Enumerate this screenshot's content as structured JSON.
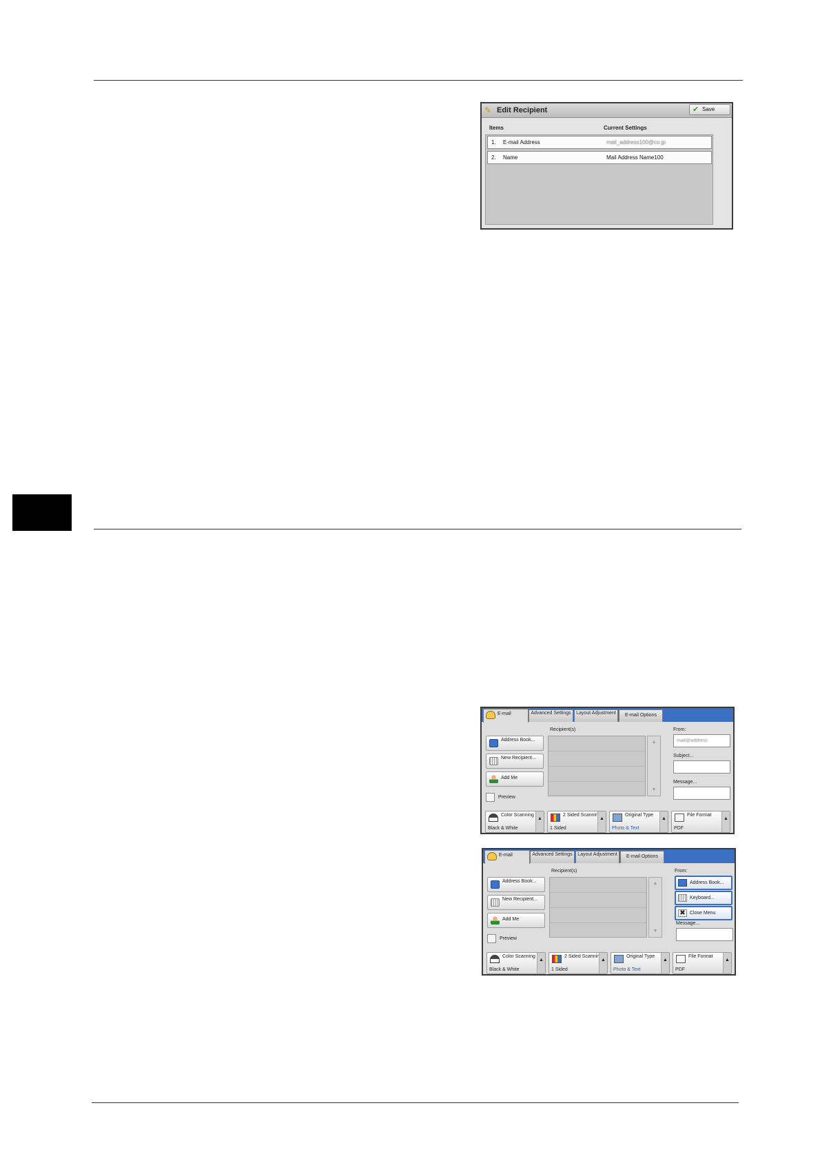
{
  "edit_recipient": {
    "title": "Edit Recipient",
    "save_label": "Save",
    "col_items": "Items",
    "col_current": "Current Settings",
    "rows": [
      {
        "num": "1.",
        "item": "E-mail Address",
        "value": "mail_address100@co.jp"
      },
      {
        "num": "2.",
        "item": "Name",
        "value": "Mail Address Name100"
      }
    ]
  },
  "email_screen": {
    "tabs": [
      "E-mail",
      "Advanced Settings",
      "Layout Adjustment",
      "E-mail Options"
    ],
    "address_book": "Address Book...",
    "new_recipient": "New Recipient...",
    "add_me": "Add Me",
    "preview": "Preview",
    "recipients_label": "Recipient(s)",
    "from_label": "From:",
    "from_value": "mail@address",
    "subject_label": "Subject...",
    "message_label": "Message...",
    "features": [
      {
        "title": "Color Scanning",
        "value": "Black & White"
      },
      {
        "title": "2 Sided Scanning",
        "value": "1 Sided"
      },
      {
        "title": "Original Type",
        "value": "Photo & Text"
      },
      {
        "title": "File Format",
        "value": "PDF"
      }
    ],
    "from_menu": [
      "Address Book...",
      "Keyboard...",
      "Close Menu"
    ]
  }
}
